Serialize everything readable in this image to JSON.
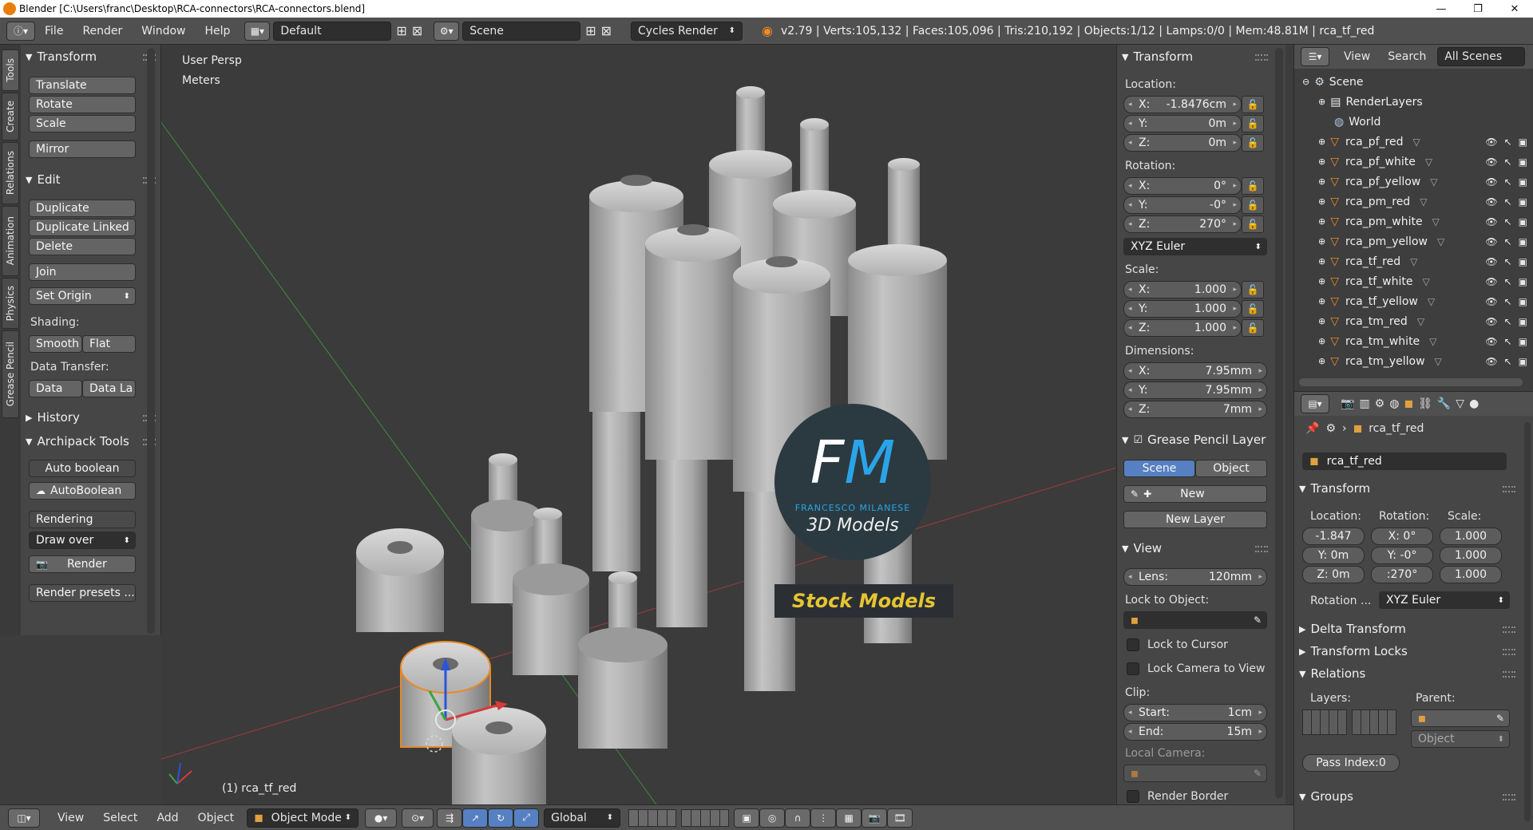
{
  "window": {
    "title": "Blender [C:\\Users\\franc\\Desktop\\RCA-connectors\\RCA-connectors.blend]",
    "min": "—",
    "max": "❐",
    "close": "✕"
  },
  "infobar": {
    "menus": [
      "File",
      "Render",
      "Window",
      "Help"
    ],
    "layout": "Default",
    "scene": "Scene",
    "engine": "Cycles Render",
    "stats": "v2.79 | Verts:105,132 | Faces:105,096 | Tris:210,192 | Objects:1/12 | Lamps:0/0 | Mem:48.81M | rca_tf_red"
  },
  "tabs": [
    "Tools",
    "Create",
    "Relations",
    "Animation",
    "Physics",
    "Grease Pencil"
  ],
  "toolshelf": {
    "transform_title": "Transform",
    "translate": "Translate",
    "rotate": "Rotate",
    "scale": "Scale",
    "mirror": "Mirror",
    "edit_title": "Edit",
    "duplicate": "Duplicate",
    "duplicate_linked": "Duplicate Linked",
    "delete": "Delete",
    "join": "Join",
    "set_origin": "Set Origin",
    "shading_label": "Shading:",
    "smooth": "Smooth",
    "flat": "Flat",
    "data_transfer_label": "Data Transfer:",
    "data": "Data",
    "data_la": "Data La",
    "history_title": "History",
    "archipack_title": "Archipack Tools",
    "auto_boolean_label": "Auto boolean",
    "autoboolean_btn": "AutoBoolean",
    "rendering_label": "Rendering",
    "draw_over": "Draw over",
    "render_btn": "Render",
    "render_presets": "Render presets ..."
  },
  "viewport": {
    "view_name": "User Persp",
    "units": "Meters",
    "active_object": "(1) rca_tf_red",
    "watermark_fm": "FM",
    "watermark_name": "FRANCESCO MILANESE",
    "watermark_models": "3D Models",
    "watermark_stock": "Stock Models"
  },
  "npanel": {
    "transform_title": "Transform",
    "location_label": "Location:",
    "loc_x": "-1.8476cm",
    "loc_y": "0m",
    "loc_z": "0m",
    "rotation_label": "Rotation:",
    "rot_x": "0°",
    "rot_y": "-0°",
    "rot_z": "270°",
    "rot_mode": "XYZ Euler",
    "scale_label": "Scale:",
    "scale_x": "1.000",
    "scale_y": "1.000",
    "scale_z": "1.000",
    "dimensions_label": "Dimensions:",
    "dim_x": "7.95mm",
    "dim_y": "7.95mm",
    "dim_z": "7mm",
    "gp_title": "Grease Pencil Layer",
    "gp_scene": "Scene",
    "gp_object": "Object",
    "gp_new": "New",
    "gp_new_layer": "New Layer",
    "view_title": "View",
    "lens_key": "Lens:",
    "lens": "120mm",
    "lock_to_object": "Lock to Object:",
    "lock_to_cursor": "Lock to Cursor",
    "lock_camera": "Lock Camera to View",
    "clip_label": "Clip:",
    "clip_start_key": "Start:",
    "clip_start": "1cm",
    "clip_end_key": "End:",
    "clip_end": "15m",
    "local_camera": "Local Camera:",
    "render_border": "Render Border"
  },
  "outliner": {
    "view": "View",
    "search": "Search",
    "filter": "All Scenes",
    "scene": "Scene",
    "renderlayers": "RenderLayers",
    "world": "World",
    "objects": [
      "rca_pf_red",
      "rca_pf_white",
      "rca_pf_yellow",
      "rca_pm_red",
      "rca_pm_white",
      "rca_pm_yellow",
      "rca_tf_red",
      "rca_tf_white",
      "rca_tf_yellow",
      "rca_tm_red",
      "rca_tm_white",
      "rca_tm_yellow"
    ]
  },
  "props": {
    "object_path": "rca_tf_red",
    "object_name": "rca_tf_red",
    "transform_title": "Transform",
    "location_label": "Location:",
    "rotation_label": "Rotation:",
    "scale_label": "Scale:",
    "loc": [
      "-1.847",
      "Y: 0m",
      "Z: 0m"
    ],
    "rot": [
      "X: 0°",
      "Y: -0°",
      ":270°"
    ],
    "scale": [
      "1.000",
      "1.000",
      "1.000"
    ],
    "rotation_mode_label": "Rotation ...",
    "rotation_mode": "XYZ Euler",
    "delta_transform": "Delta Transform",
    "transform_locks": "Transform Locks",
    "relations": "Relations",
    "layers_label": "Layers:",
    "parent_label": "Parent:",
    "parent_type": "Object",
    "pass_index": "Pass Index:0",
    "groups": "Groups"
  },
  "bottombar": {
    "menus": [
      "View",
      "Select",
      "Add",
      "Object"
    ],
    "mode": "Object Mode",
    "orientation": "Global"
  }
}
